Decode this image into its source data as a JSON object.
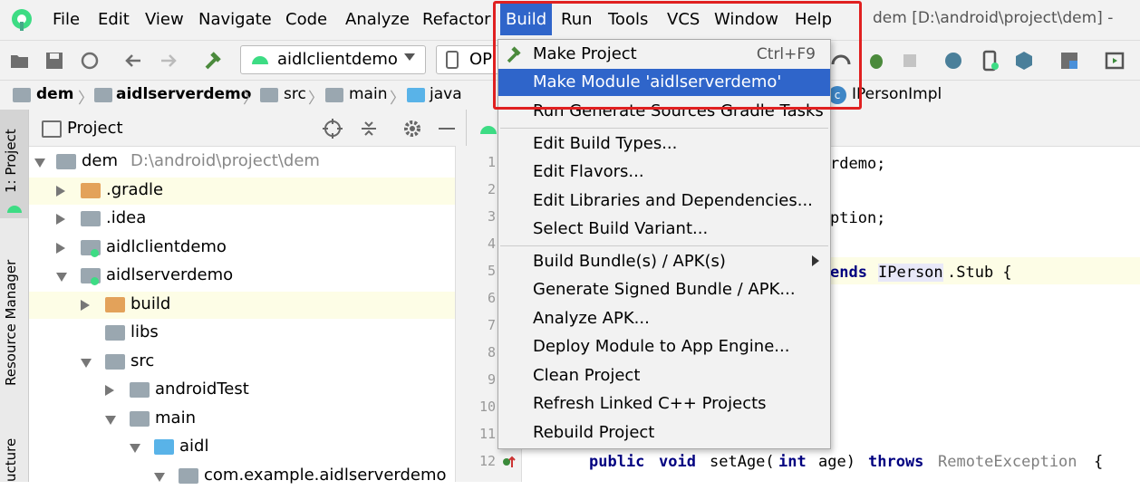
{
  "colors": {
    "menubar_bg": "#f2f2f2",
    "selection": "#2f65ca",
    "highlight_box": "#e02020",
    "keyword": "#000080"
  },
  "menubar": {
    "items": [
      "File",
      "Edit",
      "View",
      "Navigate",
      "Code",
      "Analyze",
      "Refactor",
      "Build",
      "Run",
      "Tools",
      "VCS",
      "Window",
      "Help"
    ],
    "active": "Build",
    "title": "dem [D:\\android\\project\\dem] -"
  },
  "toolbar": {
    "run_config": "aidlclientdemo",
    "device_partial": "OP"
  },
  "breadcrumb": [
    "dem",
    "aidlserverdemo",
    "src",
    "main",
    "java"
  ],
  "breadcrumb_tail": "IPersonImpl",
  "left_strip": {
    "project_tab": "1: Project",
    "resource_tab": "Resource Manager",
    "structure_tab": "ucture"
  },
  "project_panel": {
    "title": "Project",
    "tree": [
      {
        "name": "dem",
        "path": "D:\\android\\project\\dem"
      },
      {
        "name": ".gradle"
      },
      {
        "name": ".idea"
      },
      {
        "name": "aidlclientdemo"
      },
      {
        "name": "aidlserverdemo"
      },
      {
        "name": "build"
      },
      {
        "name": "libs"
      },
      {
        "name": "src"
      },
      {
        "name": "androidTest"
      },
      {
        "name": "main"
      },
      {
        "name": "aidl"
      },
      {
        "name": "com.example.aidlserverdemo"
      }
    ]
  },
  "editor": {
    "line_numbers": [
      "1",
      "2",
      "3",
      "4",
      "5",
      "6",
      "7",
      "8",
      "9",
      "10",
      "11",
      "12"
    ],
    "frag_line1": "rdemo;",
    "frag_line3": "ption;",
    "frag_line5_kw": "ends",
    "frag_line5_type": "IPerson",
    "frag_line5_rest": ".Stub {",
    "line12": {
      "public": "public",
      "void": "void",
      "method": "setAge(",
      "int": "int",
      "param": "age)",
      "throws": "throws",
      "exc": "RemoteException",
      "brace": "{"
    }
  },
  "build_menu": {
    "items": [
      {
        "label": "Make Project",
        "shortcut": "Ctrl+F9"
      },
      {
        "label": "Make Module 'aidlserverdemo'",
        "selected": true
      },
      {
        "label": "Run Generate Sources Gradle Tasks"
      },
      {
        "label": "Edit Build Types..."
      },
      {
        "label": "Edit Flavors..."
      },
      {
        "label": "Edit Libraries and Dependencies..."
      },
      {
        "label": "Select Build Variant..."
      },
      {
        "label": "Build Bundle(s) / APK(s)",
        "submenu": true
      },
      {
        "label": "Generate Signed Bundle / APK..."
      },
      {
        "label": "Analyze APK..."
      },
      {
        "label": "Deploy Module to App Engine..."
      },
      {
        "label": "Clean Project"
      },
      {
        "label": "Refresh Linked C++ Projects"
      },
      {
        "label": "Rebuild Project"
      }
    ]
  }
}
